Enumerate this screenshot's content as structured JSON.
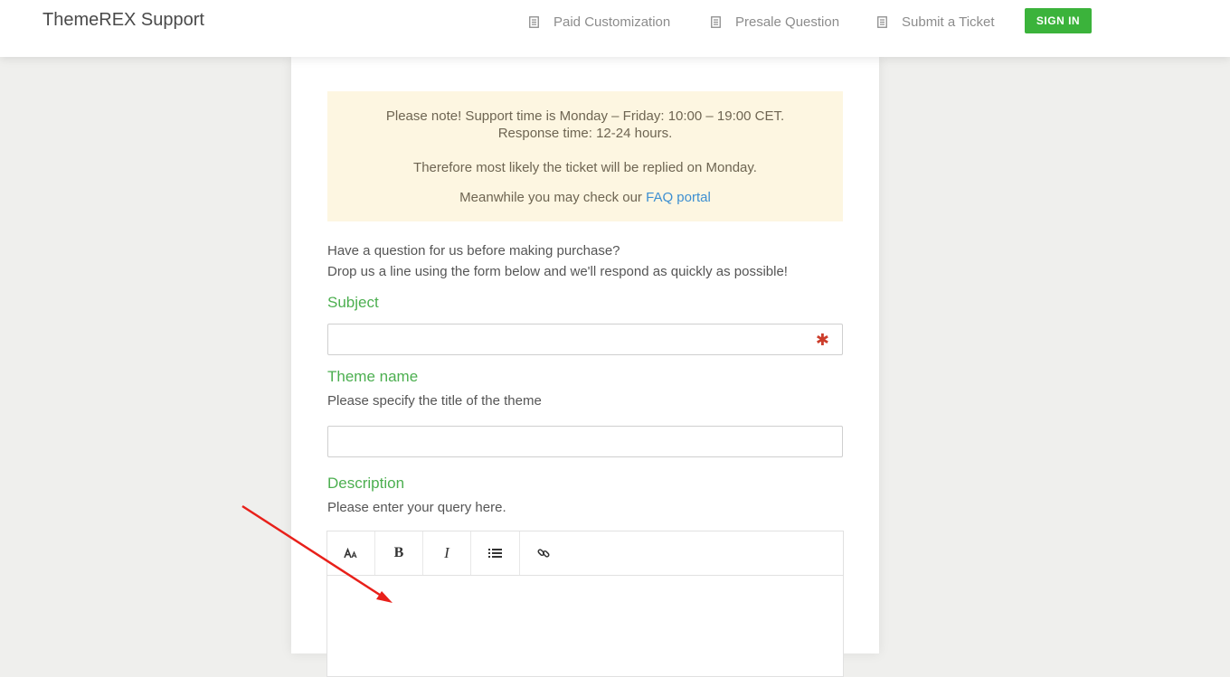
{
  "header": {
    "brand": "ThemeREX Support",
    "nav": [
      {
        "label": "Paid Customization",
        "icon": "document-icon"
      },
      {
        "label": "Presale Question",
        "icon": "document-icon"
      },
      {
        "label": "Submit a Ticket",
        "icon": "document-icon"
      }
    ],
    "signin_label": "SIGN IN"
  },
  "notice": {
    "line1": "Please note! Support time is Monday – Friday: 10:00 – 19:00 CET.",
    "line2": "Response time: 12-24 hours.",
    "line3": "Therefore most likely the ticket will be replied on Monday.",
    "line4_prefix": "Meanwhile you may check our ",
    "faq_link": "FAQ portal"
  },
  "intro": {
    "line1": "Have a question for us before making purchase?",
    "line2": "Drop us a line using the form below and we'll respond as quickly as possible!"
  },
  "form": {
    "subject": {
      "label": "Subject",
      "required_mark": "✱"
    },
    "theme_name": {
      "label": "Theme name",
      "hint": "Please specify the title of the theme"
    },
    "description": {
      "label": "Description",
      "hint": "Please enter your query here."
    }
  },
  "editor_toolbar": {
    "buttons": [
      "font-size-icon",
      "bold-icon",
      "italic-icon",
      "list-icon",
      "link-icon"
    ],
    "bold_glyph": "B",
    "italic_glyph": "I"
  },
  "colors": {
    "accent_green": "#4caf50",
    "signin_green": "#3bb33b",
    "notice_bg": "#fdf6e1",
    "link_blue": "#3d8fd1",
    "annotation_red": "#e8201a"
  }
}
